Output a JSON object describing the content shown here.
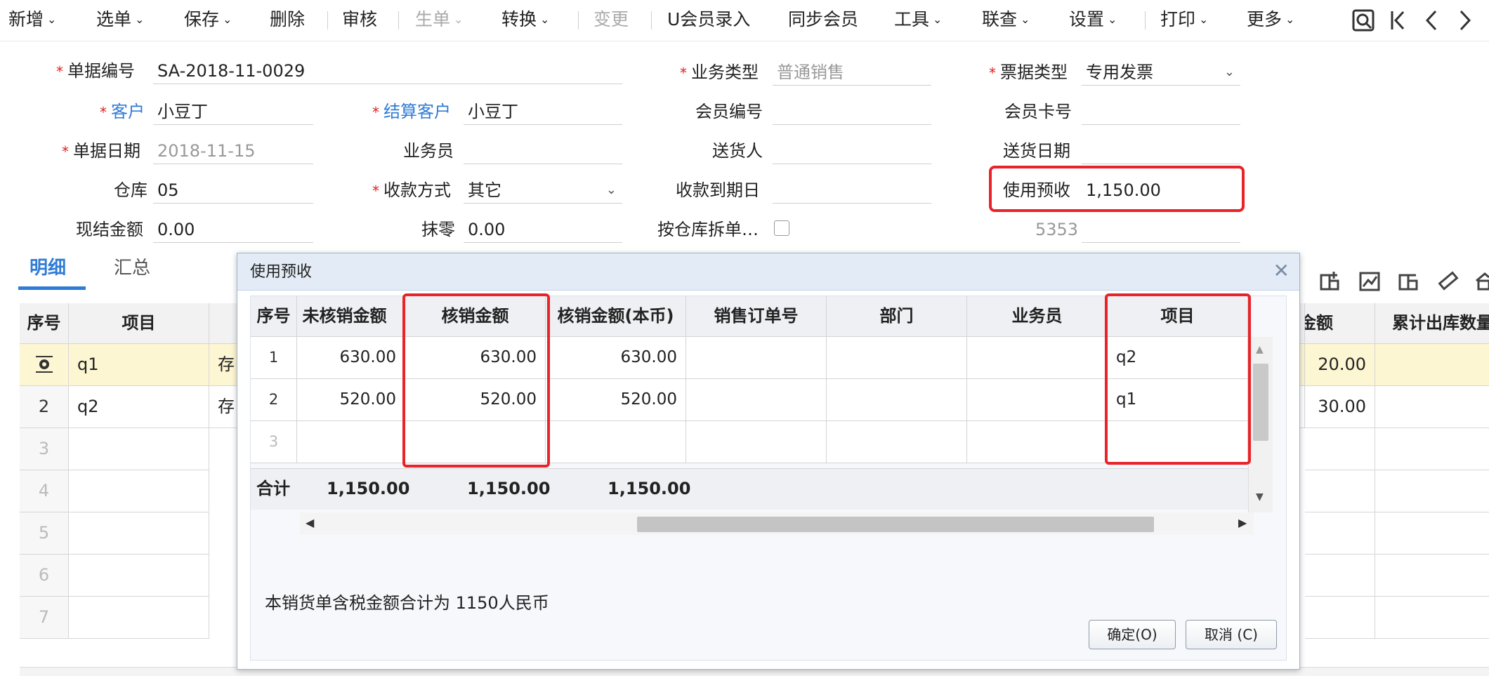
{
  "toolbar": {
    "items": [
      {
        "label": "新增",
        "dropdown": true
      },
      {
        "label": "选单",
        "dropdown": true
      },
      {
        "label": "保存",
        "dropdown": true
      },
      {
        "label": "删除",
        "dropdown": false
      },
      {
        "label": "审核",
        "dropdown": false
      },
      {
        "label": "生单",
        "dropdown": true,
        "disabled": true
      },
      {
        "label": "转换",
        "dropdown": true
      },
      {
        "label": "变更",
        "dropdown": false,
        "disabled": true
      },
      {
        "label": "U会员录入",
        "dropdown": false
      },
      {
        "label": "同步会员",
        "dropdown": false
      },
      {
        "label": "工具",
        "dropdown": true
      },
      {
        "label": "联查",
        "dropdown": true
      },
      {
        "label": "设置",
        "dropdown": true
      },
      {
        "label": "打印",
        "dropdown": true
      },
      {
        "label": "更多",
        "dropdown": true
      }
    ],
    "nav_icons": [
      "locate-icon",
      "first-record-icon",
      "previous-record-icon",
      "next-record-icon"
    ]
  },
  "form": {
    "doc_no": {
      "label": "单据编号",
      "value": "SA-2018-11-0029",
      "required": true
    },
    "biz_type": {
      "label": "业务类型",
      "value": "普通销售",
      "required": true
    },
    "invoice_type": {
      "label": "票据类型",
      "value": "专用发票",
      "required": true
    },
    "customer": {
      "label": "客户",
      "value": "小豆丁",
      "required": true
    },
    "settle_customer": {
      "label": "结算客户",
      "value": "小豆丁",
      "required": true
    },
    "member_no": {
      "label": "会员编号",
      "value": ""
    },
    "member_card": {
      "label": "会员卡号",
      "value": ""
    },
    "doc_date": {
      "label": "单据日期",
      "value": "2018-11-15",
      "required": true
    },
    "salesperson": {
      "label": "业务员",
      "value": ""
    },
    "deliverer": {
      "label": "送货人",
      "value": ""
    },
    "delivery_date": {
      "label": "送货日期",
      "value": ""
    },
    "warehouse": {
      "label": "仓库",
      "value": "05"
    },
    "payment_method": {
      "label": "收款方式",
      "value": "其它",
      "required": true
    },
    "due_date": {
      "label": "收款到期日",
      "value": ""
    },
    "use_prepay": {
      "label": "使用预收",
      "value": "1,150.00"
    },
    "cash_amount": {
      "label": "现结金额",
      "value": "0.00"
    },
    "rounding": {
      "label": "抹零",
      "value": "0.00"
    },
    "split_by_wh": {
      "label": "按仓库拆单…",
      "checked": false
    },
    "extra_code": "5353"
  },
  "tabs": [
    {
      "label": "明细",
      "active": true
    },
    {
      "label": "汇总",
      "active": false
    }
  ],
  "detail_grid": {
    "headers": {
      "seq": "序号",
      "item": "项目",
      "amount": "金额",
      "cum_out_qty": "累计出库数量"
    },
    "rows": [
      {
        "seq": "",
        "item": "q1",
        "partial": "存",
        "amount": "20.00"
      },
      {
        "seq": "2",
        "item": "q2",
        "partial": "存",
        "amount": "30.00"
      },
      {
        "seq": "3"
      },
      {
        "seq": "4"
      },
      {
        "seq": "5"
      },
      {
        "seq": "6"
      },
      {
        "seq": "7"
      }
    ],
    "toolbar_icons": [
      "insert-row-icon",
      "chart-icon",
      "delete-row-icon",
      "ruler-icon",
      "home-icon"
    ]
  },
  "dialog": {
    "title": "使用预收",
    "columns": [
      "序号",
      "未核销金额",
      "核销金额",
      "核销金额(本币)",
      "销售订单号",
      "部门",
      "业务员",
      "项目"
    ],
    "rows": [
      {
        "seq": "1",
        "unverified": "630.00",
        "verified": "630.00",
        "verified_local": "630.00",
        "so_no": "",
        "dept": "",
        "salesperson": "",
        "project": "q2"
      },
      {
        "seq": "2",
        "unverified": "520.00",
        "verified": "520.00",
        "verified_local": "520.00",
        "so_no": "",
        "dept": "",
        "salesperson": "",
        "project": "q1"
      },
      {
        "seq": "3"
      }
    ],
    "total": {
      "label": "合计",
      "unverified": "1,150.00",
      "verified": "1,150.00",
      "verified_local": "1,150.00"
    },
    "note": "本销货单含税金额合计为 1150人民币",
    "ok_label": "确定(O)",
    "cancel_label": "取消 (C)"
  },
  "colors": {
    "accent": "#2f7bd6",
    "highlight": "#e8232a",
    "selected_row": "#fdf6d3"
  }
}
